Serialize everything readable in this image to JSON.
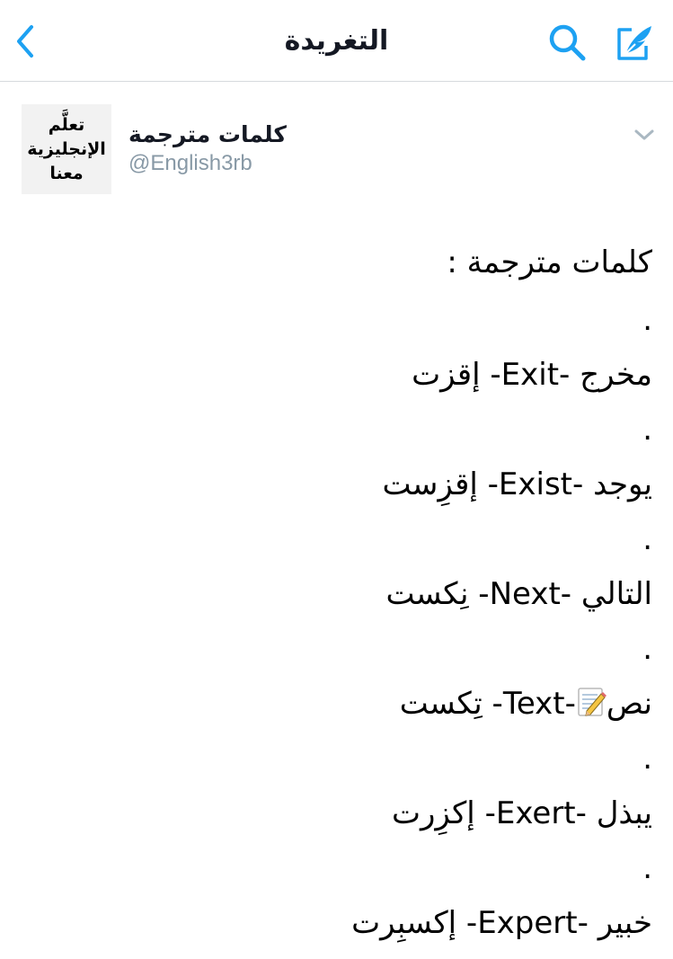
{
  "nav": {
    "title": "التغريدة"
  },
  "author": {
    "name": "كلمات مترجمة",
    "handle": "@English3rb",
    "avatar_lines": [
      "تعلَّم",
      "الإنجليزية",
      "معنا"
    ]
  },
  "tweet": {
    "heading": "كلمات مترجمة :",
    "dot": ".",
    "lines": [
      "مخرج -Exit- إقزت",
      "يوجد -Exist- إقزِست",
      "التالي -Next- نِكست",
      "نص",
      "يبذل -Exert- إكزِرت",
      "خبير -Expert- إكسبِرت"
    ],
    "text_line_tail": "-Text- تِكست"
  },
  "icons": {
    "back": "chevron-left-icon",
    "search": "search-icon",
    "compose": "compose-tweet-icon",
    "more": "chevron-down-icon",
    "memo": "memo-icon"
  },
  "colors": {
    "accent": "#1da1f2",
    "secondary_text": "#8899a6",
    "divider": "#d6dadd"
  }
}
